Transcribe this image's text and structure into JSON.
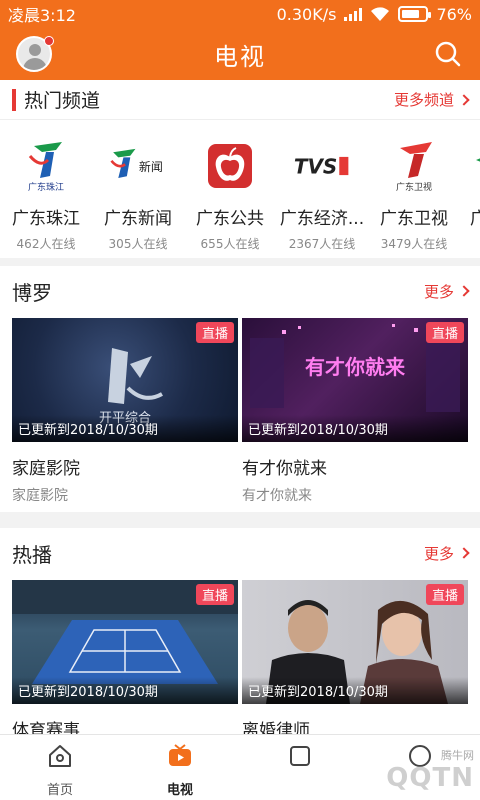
{
  "status_bar": {
    "time": "凌晨3:12",
    "speed": "0.30K/s",
    "battery_percent": "76%",
    "battery_level": 0.76
  },
  "app_bar": {
    "title": "电视"
  },
  "hot_channels": {
    "title": "热门频道",
    "more_label": "更多频道",
    "items": [
      {
        "name": "广东珠江",
        "viewers": "462人在线",
        "logo_text": "广东珠江"
      },
      {
        "name": "广东新闻",
        "viewers": "305人在线",
        "logo_text": "新闻"
      },
      {
        "name": "广东公共",
        "viewers": "655人在线"
      },
      {
        "name": "广东经济...",
        "viewers": "2367人在线",
        "logo_text": "TVS"
      },
      {
        "name": "广东卫视",
        "viewers": "3479人在线",
        "logo_text": "广东卫视"
      },
      {
        "name": "广"
      }
    ]
  },
  "section_boluo": {
    "title": "博罗",
    "more_label": "更多",
    "cards": [
      {
        "title": "家庭影院",
        "subtitle": "家庭影院",
        "badge": "直播",
        "updated": "已更新到2018/10/30期",
        "thumb_text": "开平综合"
      },
      {
        "title": "有才你就来",
        "subtitle": "有才你就来",
        "badge": "直播",
        "updated": "已更新到2018/10/30期",
        "thumb_text": "有才你就来"
      }
    ]
  },
  "section_hot": {
    "title": "热播",
    "more_label": "更多",
    "cards": [
      {
        "title": "体育赛事",
        "badge": "直播",
        "updated": "已更新到2018/10/30期"
      },
      {
        "title": "离婚律师",
        "badge": "直播",
        "updated": "已更新到2018/10/30期"
      }
    ]
  },
  "bottom_nav": {
    "items": [
      {
        "label": "首页"
      },
      {
        "label": "电视"
      }
    ]
  },
  "watermark": {
    "text": "QQTN",
    "sub": "腾牛网"
  },
  "colors": {
    "brand": "#f26f1c",
    "accent_red": "#e53935",
    "badge": "#f0475a"
  }
}
